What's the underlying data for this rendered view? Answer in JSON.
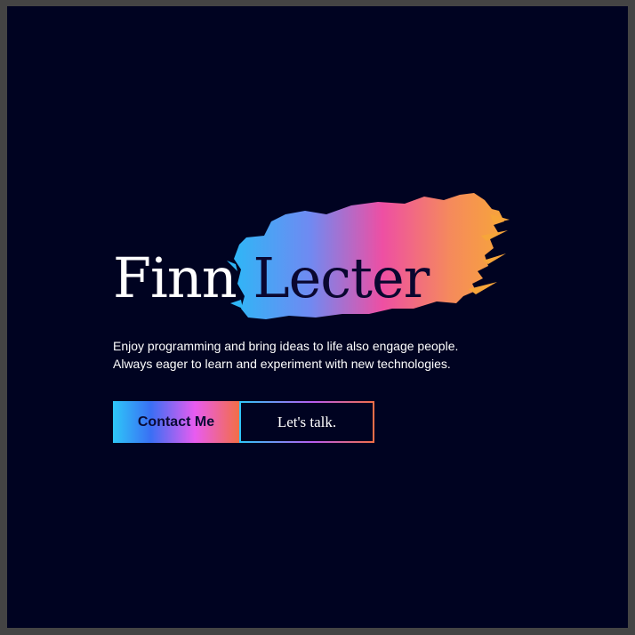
{
  "hero": {
    "first_name": "Finn",
    "last_name": "Lecter",
    "tagline_line1": "Enjoy programming and bring ideas to life also engage people.",
    "tagline_line2": "Always eager to learn and experiment with new technologies.",
    "contact_label": "Contact Me",
    "talk_label": "Let's talk."
  },
  "colors": {
    "background": "#000321",
    "text": "#ffffff",
    "brush_gradient": [
      "#2fb6f6",
      "#6f8af2",
      "#ee4fa3",
      "#f58a5c",
      "#f7a53a"
    ]
  }
}
